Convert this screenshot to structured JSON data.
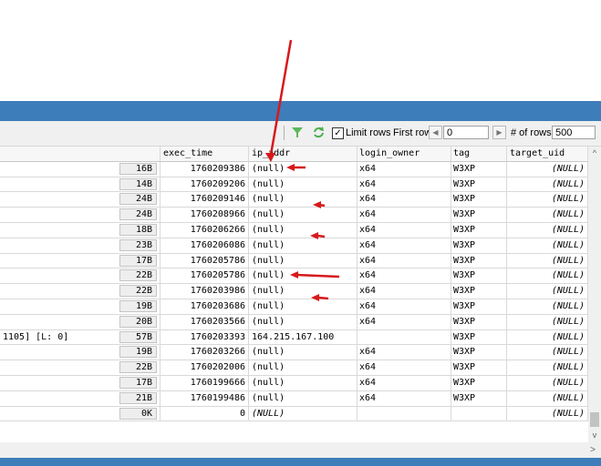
{
  "toolbar": {
    "limit_rows_label": "Limit rows",
    "limit_rows_checked": true,
    "first_row_label": "First row",
    "first_row_value": "0",
    "num_rows_label": "# of rows",
    "num_rows_value": "500",
    "icons": [
      "filter-icon",
      "refresh-icon"
    ]
  },
  "grid": {
    "columns": [
      "",
      "exec_time",
      "ip_addr",
      "login_owner",
      "tag",
      "target_uid"
    ],
    "rows": [
      {
        "pre": "",
        "size": "16B",
        "exec_time": "1760209386",
        "ip": "(null)",
        "login": "x64",
        "tag": "W3XP",
        "uid": "(NULL)"
      },
      {
        "pre": "",
        "size": "14B",
        "exec_time": "1760209206",
        "ip": "(null)",
        "login": "x64",
        "tag": "W3XP",
        "uid": "(NULL)"
      },
      {
        "pre": "",
        "size": "24B",
        "exec_time": "1760209146",
        "ip": "(null)",
        "login": "x64",
        "tag": "W3XP",
        "uid": "(NULL)"
      },
      {
        "pre": "",
        "size": "24B",
        "exec_time": "1760208966",
        "ip": "(null)",
        "login": "x64",
        "tag": "W3XP",
        "uid": "(NULL)"
      },
      {
        "pre": "",
        "size": "18B",
        "exec_time": "1760206266",
        "ip": "(null)",
        "login": "x64",
        "tag": "W3XP",
        "uid": "(NULL)"
      },
      {
        "pre": "",
        "size": "23B",
        "exec_time": "1760206086",
        "ip": "(null)",
        "login": "x64",
        "tag": "W3XP",
        "uid": "(NULL)"
      },
      {
        "pre": "",
        "size": "17B",
        "exec_time": "1760205786",
        "ip": "(null)",
        "login": "x64",
        "tag": "W3XP",
        "uid": "(NULL)"
      },
      {
        "pre": "",
        "size": "22B",
        "exec_time": "1760205786",
        "ip": "(null)",
        "login": "x64",
        "tag": "W3XP",
        "uid": "(NULL)"
      },
      {
        "pre": "",
        "size": "22B",
        "exec_time": "1760203986",
        "ip": "(null)",
        "login": "x64",
        "tag": "W3XP",
        "uid": "(NULL)"
      },
      {
        "pre": "",
        "size": "19B",
        "exec_time": "1760203686",
        "ip": "(null)",
        "login": "x64",
        "tag": "W3XP",
        "uid": "(NULL)"
      },
      {
        "pre": "",
        "size": "20B",
        "exec_time": "1760203566",
        "ip": "(null)",
        "login": "x64",
        "tag": "W3XP",
        "uid": "(NULL)"
      },
      {
        "pre": "1105] [L: 0]",
        "size": "57B",
        "exec_time": "1760203393",
        "ip": "164.215.167.100",
        "login": "",
        "tag": "W3XP",
        "uid": "(NULL)"
      },
      {
        "pre": "",
        "size": "19B",
        "exec_time": "1760203266",
        "ip": "(null)",
        "login": "x64",
        "tag": "W3XP",
        "uid": "(NULL)"
      },
      {
        "pre": "",
        "size": "22B",
        "exec_time": "1760202006",
        "ip": "(null)",
        "login": "x64",
        "tag": "W3XP",
        "uid": "(NULL)"
      },
      {
        "pre": "",
        "size": "17B",
        "exec_time": "1760199666",
        "ip": "(null)",
        "login": "x64",
        "tag": "W3XP",
        "uid": "(NULL)"
      },
      {
        "pre": "",
        "size": "21B",
        "exec_time": "1760199486",
        "ip": "(null)",
        "login": "x64",
        "tag": "W3XP",
        "uid": "(NULL)"
      },
      {
        "pre": "",
        "size": "0K",
        "exec_time": "0",
        "ip": "(NULL)",
        "login": "",
        "tag": "",
        "uid": "(NULL)"
      }
    ]
  },
  "annotation_color": "#d7191c"
}
